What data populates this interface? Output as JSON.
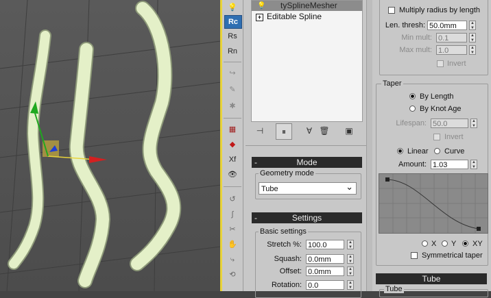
{
  "modifier_stack": {
    "items": [
      {
        "label": "tySplineMesher",
        "selected": true
      },
      {
        "label": "Editable Spline",
        "selected": false,
        "expand": "+"
      }
    ]
  },
  "side_toolbar": {
    "buttons": [
      "Rc",
      "Rs",
      "Rn",
      "Xf"
    ],
    "active": "Rc"
  },
  "mode_rollout": {
    "title": "Mode",
    "toggle": "-",
    "geometry_mode_label": "Geometry mode",
    "geometry_mode_value": "Tube",
    "dropdown_arrow": "⌄"
  },
  "settings_rollout": {
    "title": "Settings",
    "toggle": "-",
    "basic_settings_label": "Basic settings",
    "fields": [
      {
        "label": "Stretch %:",
        "value": "100.0"
      },
      {
        "label": "Squash:",
        "value": "0.0mm"
      },
      {
        "label": "Offset:",
        "value": "0.0mm"
      },
      {
        "label": "Rotation:",
        "value": "0.0"
      }
    ]
  },
  "radius_section": {
    "multiply_label": "Multiply radius by length",
    "multiply_checked": false,
    "fields": [
      {
        "label": "Len. thresh:",
        "value": "50.0mm",
        "enabled": true
      },
      {
        "label": "Min mult:",
        "value": "0.1",
        "enabled": false
      },
      {
        "label": "Max mult:",
        "value": "1.0",
        "enabled": false
      }
    ],
    "invert_label": "Invert"
  },
  "taper": {
    "title": "Taper",
    "by_length_label": "By Length",
    "by_knot_age_label": "By Knot Age",
    "selected_mode": "By Length",
    "lifespan_label": "Lifespan:",
    "lifespan_value": "50.0",
    "invert_label": "Invert",
    "linear_label": "Linear",
    "curve_label": "Curve",
    "selected_interp": "Linear",
    "amount_label": "Amount:",
    "amount_value": "1.03",
    "axis_x": "X",
    "axis_y": "Y",
    "axis_xy": "XY",
    "selected_axis": "XY",
    "symmetrical_label": "Symmetrical taper"
  },
  "tube_rollout": {
    "title": "Tube",
    "group_label": "Tube"
  },
  "colors": {
    "panel_bg": "#c8c8c8",
    "viewport_bg": "#505050",
    "viewport_border": "#e8d33a",
    "rollout_header": "#2a2a2a",
    "tube_mesh": "#e4f0c8",
    "gizmo_x": "#d42020",
    "gizmo_y": "#1fa81f",
    "gizmo_z": "#1f3fd4",
    "active_tool": "#2f6fb2"
  }
}
